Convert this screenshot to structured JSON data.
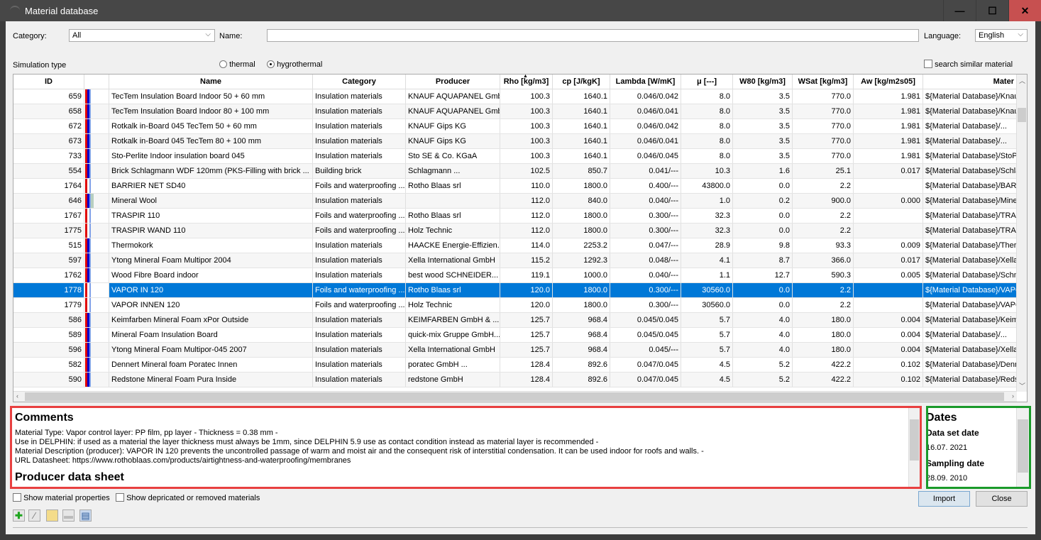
{
  "window": {
    "title": "Material database",
    "minimize": "—",
    "maximize": "☐",
    "close": "✕"
  },
  "filters": {
    "category_label": "Category:",
    "category_value": "All",
    "name_label": "Name:",
    "name_value": "",
    "language_label": "Language:",
    "language_value": "English"
  },
  "simulation": {
    "label": "Simulation type",
    "thermal": "thermal",
    "hygrothermal": "hygrothermal",
    "selected": "hygrothermal",
    "search_similar": "search similar material"
  },
  "table": {
    "columns": [
      "ID",
      "",
      "Name",
      "Category",
      "Producer",
      "Rho [kg/m3]",
      "cp [J/kgK]",
      "Lambda [W/mK]",
      "μ [---]",
      "W80 [kg/m3]",
      "WSat [kg/m3]",
      "Aw [kg/m2s05]",
      "Mater"
    ],
    "sorted_column": "Rho [kg/m3]",
    "selected_id": "1778",
    "stripe_colors": {
      "red": "#e00000",
      "blue": "#0000d0",
      "light": "#7fa0e8",
      "green": "#b8cfc0"
    },
    "rows": [
      [
        "659",
        "full",
        "TecTem Insulation Board Indoor 50 + 60 mm",
        "Insulation materials",
        "KNAUF AQUAPANEL GmbH",
        "100.3",
        "1640.1",
        "0.046/0.042",
        "8.0",
        "3.5",
        "770.0",
        "1.981",
        "${Material Database}/Knau"
      ],
      [
        "658",
        "full",
        "TecTem Insulation Board Indoor 80 + 100 mm",
        "Insulation materials",
        "KNAUF AQUAPANEL GmbH",
        "100.3",
        "1640.1",
        "0.046/0.041",
        "8.0",
        "3.5",
        "770.0",
        "1.981",
        "${Material Database}/Knau"
      ],
      [
        "672",
        "full",
        "Rotkalk in-Board 045 TecTem 50 + 60 mm",
        "Insulation materials",
        "KNAUF Gips KG",
        "100.3",
        "1640.1",
        "0.046/0.042",
        "8.0",
        "3.5",
        "770.0",
        "1.981",
        "${Material Database}/..."
      ],
      [
        "673",
        "full",
        "Rotkalk in-Board 045 TecTem 80 + 100 mm",
        "Insulation materials",
        "KNAUF Gips KG",
        "100.3",
        "1640.1",
        "0.046/0.041",
        "8.0",
        "3.5",
        "770.0",
        "1.981",
        "${Material Database}/..."
      ],
      [
        "733",
        "full",
        "Sto-Perlite Indoor insulation board 045",
        "Insulation materials",
        "Sto SE & Co. KGaA",
        "100.3",
        "1640.1",
        "0.046/0.045",
        "8.0",
        "3.5",
        "770.0",
        "1.981",
        "${Material Database}/StoPe"
      ],
      [
        "554",
        "full",
        "Brick Schlagmann WDF 120mm (PKS-Filling with brick ...",
        "Building brick",
        "Schlagmann ...",
        "102.5",
        "850.7",
        "0.041/---",
        "10.3",
        "1.6",
        "25.1",
        "0.017",
        "${Material Database}/Schla"
      ],
      [
        "1764",
        "foil",
        "BARRIER NET SD40",
        "Foils and waterproofing ...",
        "Rotho Blaas srl",
        "110.0",
        "1800.0",
        "0.400/---",
        "43800.0",
        "0.0",
        "2.2",
        "",
        "${Material Database}/BARR"
      ],
      [
        "646",
        "wool",
        "Mineral Wool",
        "Insulation materials",
        "",
        "112.0",
        "840.0",
        "0.040/---",
        "1.0",
        "0.2",
        "900.0",
        "0.000",
        "${Material Database}/Mine"
      ],
      [
        "1767",
        "foil",
        "TRASPIR 110",
        "Foils and waterproofing ...",
        "Rotho Blaas srl",
        "112.0",
        "1800.0",
        "0.300/---",
        "32.3",
        "0.0",
        "2.2",
        "",
        "${Material Database}/TRAS"
      ],
      [
        "1775",
        "foil",
        "TRASPIR WAND 110",
        "Foils and waterproofing ...",
        "Holz Technic",
        "112.0",
        "1800.0",
        "0.300/---",
        "32.3",
        "0.0",
        "2.2",
        "",
        "${Material Database}/TRAS"
      ],
      [
        "515",
        "full",
        "Thermokork",
        "Insulation materials",
        "HAACKE Energie-Effizien...",
        "114.0",
        "2253.2",
        "0.047/---",
        "28.9",
        "9.8",
        "93.3",
        "0.009",
        "${Material Database}/Ther"
      ],
      [
        "597",
        "full",
        "Ytong Mineral Foam Multipor 2004",
        "Insulation materials",
        "Xella International GmbH",
        "115.2",
        "1292.3",
        "0.048/---",
        "4.1",
        "8.7",
        "366.0",
        "0.017",
        "${Material Database}/Xella"
      ],
      [
        "1762",
        "full",
        "Wood Fibre Board indoor",
        "Insulation materials",
        "best wood SCHNEIDER...",
        "119.1",
        "1000.0",
        "0.040/---",
        "1.1",
        "12.7",
        "590.3",
        "0.005",
        "${Material Database}/Schn"
      ],
      [
        "1778",
        "foil",
        "VAPOR IN 120",
        "Foils and waterproofing ...",
        "Rotho Blaas srl",
        "120.0",
        "1800.0",
        "0.300/---",
        "30560.0",
        "0.0",
        "2.2",
        "",
        "${Material Database}/VAPO"
      ],
      [
        "1779",
        "foil",
        "VAPOR INNEN 120",
        "Foils and waterproofing ...",
        "Holz Technic",
        "120.0",
        "1800.0",
        "0.300/---",
        "30560.0",
        "0.0",
        "2.2",
        "",
        "${Material Database}/VAPO"
      ],
      [
        "586",
        "full",
        "Keimfarben Mineral Foam xPor Outside",
        "Insulation materials",
        "KEIMFARBEN GmbH & ...",
        "125.7",
        "968.4",
        "0.045/0.045",
        "5.7",
        "4.0",
        "180.0",
        "0.004",
        "${Material Database}/Keim"
      ],
      [
        "589",
        "full",
        "Mineral Foam Insulation Board",
        "Insulation materials",
        "quick-mix Gruppe GmbH...",
        "125.7",
        "968.4",
        "0.045/0.045",
        "5.7",
        "4.0",
        "180.0",
        "0.004",
        "${Material Database}/..."
      ],
      [
        "596",
        "full",
        "Ytong Mineral Foam Multipor-045 2007",
        "Insulation materials",
        "Xella International GmbH",
        "125.7",
        "968.4",
        "0.045/---",
        "5.7",
        "4.0",
        "180.0",
        "0.004",
        "${Material Database}/Xella"
      ],
      [
        "582",
        "full",
        "Dennert Mineral foam Poratec Innen",
        "Insulation materials",
        "poratec GmbH ...",
        "128.4",
        "892.6",
        "0.047/0.045",
        "4.5",
        "5.2",
        "422.2",
        "0.102",
        "${Material Database}/Denn"
      ],
      [
        "590",
        "full",
        "Redstone Mineral Foam Pura Inside",
        "Insulation materials",
        "redstone GmbH",
        "128.4",
        "892.6",
        "0.047/0.045",
        "4.5",
        "5.2",
        "422.2",
        "0.102",
        "${Material Database}/Reds"
      ]
    ]
  },
  "comments": {
    "title": "Comments",
    "lines": [
      "Material Type: Vapor control layer: PP film, pp layer - Thickness = 0.38 mm -",
      "Use in DELPHIN: if used as a material the layer thickness must always be 1mm, since DELPHIN 5.9 use as contact condition instead as material layer is recommended -",
      "Material Description (producer): VAPOR IN 120 prevents the uncontrolled passage of warm and moist air and the consequent risk of interstitial condensation. It can be used indoor for roofs and walls. -",
      "URL Datasheet: https://www.rothoblaas.com/products/airtightness-and-waterproofing/membranes"
    ],
    "subtitle": "Producer data sheet",
    "border_color": "#e84040"
  },
  "dates": {
    "title": "Dates",
    "data_set_label": "Data set date",
    "data_set_value": "16.07. 2021",
    "sampling_label": "Sampling date",
    "sampling_value": "28.09. 2010",
    "border_color": "#1a9a2a"
  },
  "options": {
    "show_properties": "Show material properties",
    "show_deprecated": "Show depricated or removed materials"
  },
  "buttons": {
    "import": "Import",
    "close": "Close"
  },
  "toolbar": [
    "add-icon",
    "edit-icon",
    "folder-icon",
    "remove-icon",
    "document-icon"
  ]
}
